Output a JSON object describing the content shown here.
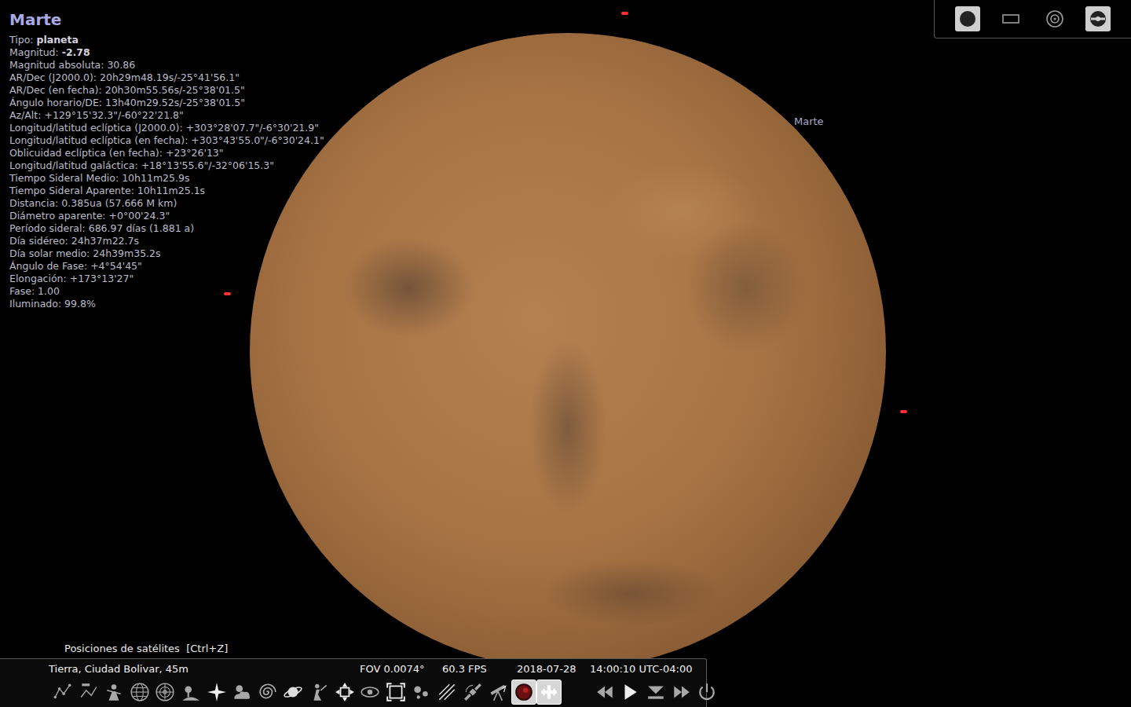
{
  "object": {
    "title": "Marte",
    "fields": [
      {
        "label": "Tipo:",
        "value": "planeta",
        "bold": true
      },
      {
        "label": "Magnitud:",
        "value": "-2.78",
        "bold": true
      },
      {
        "label": "Magnitud absoluta:",
        "value": "30.86",
        "bold": false
      },
      {
        "label": "AR/Dec (J2000.0):",
        "value": "20h29m48.19s/-25°41'56.1\"",
        "bold": false
      },
      {
        "label": "AR/Dec (en fecha):",
        "value": "20h30m55.56s/-25°38'01.5\"",
        "bold": false
      },
      {
        "label": "Ángulo horario/DE:",
        "value": "13h40m29.52s/-25°38'01.5\"",
        "bold": false
      },
      {
        "label": "Az/Alt:",
        "value": "+129°15'32.3\"/-60°22'21.8\"",
        "bold": false
      },
      {
        "label": "Longitud/latitud eclíptica (J2000.0):",
        "value": "+303°28'07.7\"/-6°30'21.9\"",
        "bold": false
      },
      {
        "label": "Longitud/latitud eclíptica (en fecha):",
        "value": "+303°43'55.0\"/-6°30'24.1\"",
        "bold": false
      },
      {
        "label": "Oblicuidad eclíptica (en fecha):",
        "value": "+23°26'13\"",
        "bold": false
      },
      {
        "label": "Longitud/latitud galáctica:",
        "value": "+18°13'55.6\"/-32°06'15.3\"",
        "bold": false
      },
      {
        "label": "Tiempo Sideral Medio:",
        "value": "10h11m25.9s",
        "bold": false
      },
      {
        "label": "Tiempo Sideral Aparente:",
        "value": "10h11m25.1s",
        "bold": false
      },
      {
        "label": "Distancia:",
        "value": "0.385ua (57.666 M km)",
        "bold": false
      },
      {
        "label": "Diámetro aparente:",
        "value": "+0°00'24.3\"",
        "bold": false
      },
      {
        "label": "Período sideral:",
        "value": "686.97 días (1.881 a)",
        "bold": false
      },
      {
        "label": "Día sidéreo:",
        "value": "24h37m22.7s",
        "bold": false
      },
      {
        "label": "Día solar medio:",
        "value": "24h39m35.2s",
        "bold": false
      },
      {
        "label": "Ángulo de Fase:",
        "value": "+4°54'45\"",
        "bold": false
      },
      {
        "label": "Elongación:",
        "value": "+173°13'27\"",
        "bold": false
      },
      {
        "label": "Fase:",
        "value": "1.00",
        "bold": false
      },
      {
        "label": "Iluminado:",
        "value": "99.8%",
        "bold": false
      }
    ]
  },
  "sky_label": "Marte",
  "view_buttons": [
    {
      "selected": true
    },
    {
      "selected": false
    },
    {
      "selected": false
    },
    {
      "selected": true
    }
  ],
  "tooltip": "Posiciones de satélites  [Ctrl+Z]",
  "status_bar": {
    "location": "Tierra, Ciudad Bolivar, 45m",
    "fov": "FOV 0.0074°",
    "fps": "60.3 FPS",
    "date": "2018-07-28",
    "time": "14:00:10 UTC-04:00"
  },
  "toolbar": {
    "buttons": [
      {
        "selected": false
      },
      {
        "selected": false
      },
      {
        "selected": false
      },
      {
        "selected": false
      },
      {
        "selected": false
      },
      {
        "selected": false
      },
      {
        "selected": false
      },
      {
        "selected": false
      },
      {
        "selected": false
      },
      {
        "selected": false
      },
      {
        "selected": false
      },
      {
        "selected": false
      },
      {
        "selected": false
      },
      {
        "selected": false
      },
      {
        "selected": false
      },
      {
        "selected": false
      },
      {
        "selected": false
      },
      {
        "selected": false
      },
      {
        "selected": true
      },
      {
        "selected": true
      }
    ],
    "time_buttons": [
      {
        "selected": false
      },
      {
        "selected": false
      },
      {
        "selected": false
      },
      {
        "selected": false
      },
      {
        "selected": false
      }
    ]
  }
}
